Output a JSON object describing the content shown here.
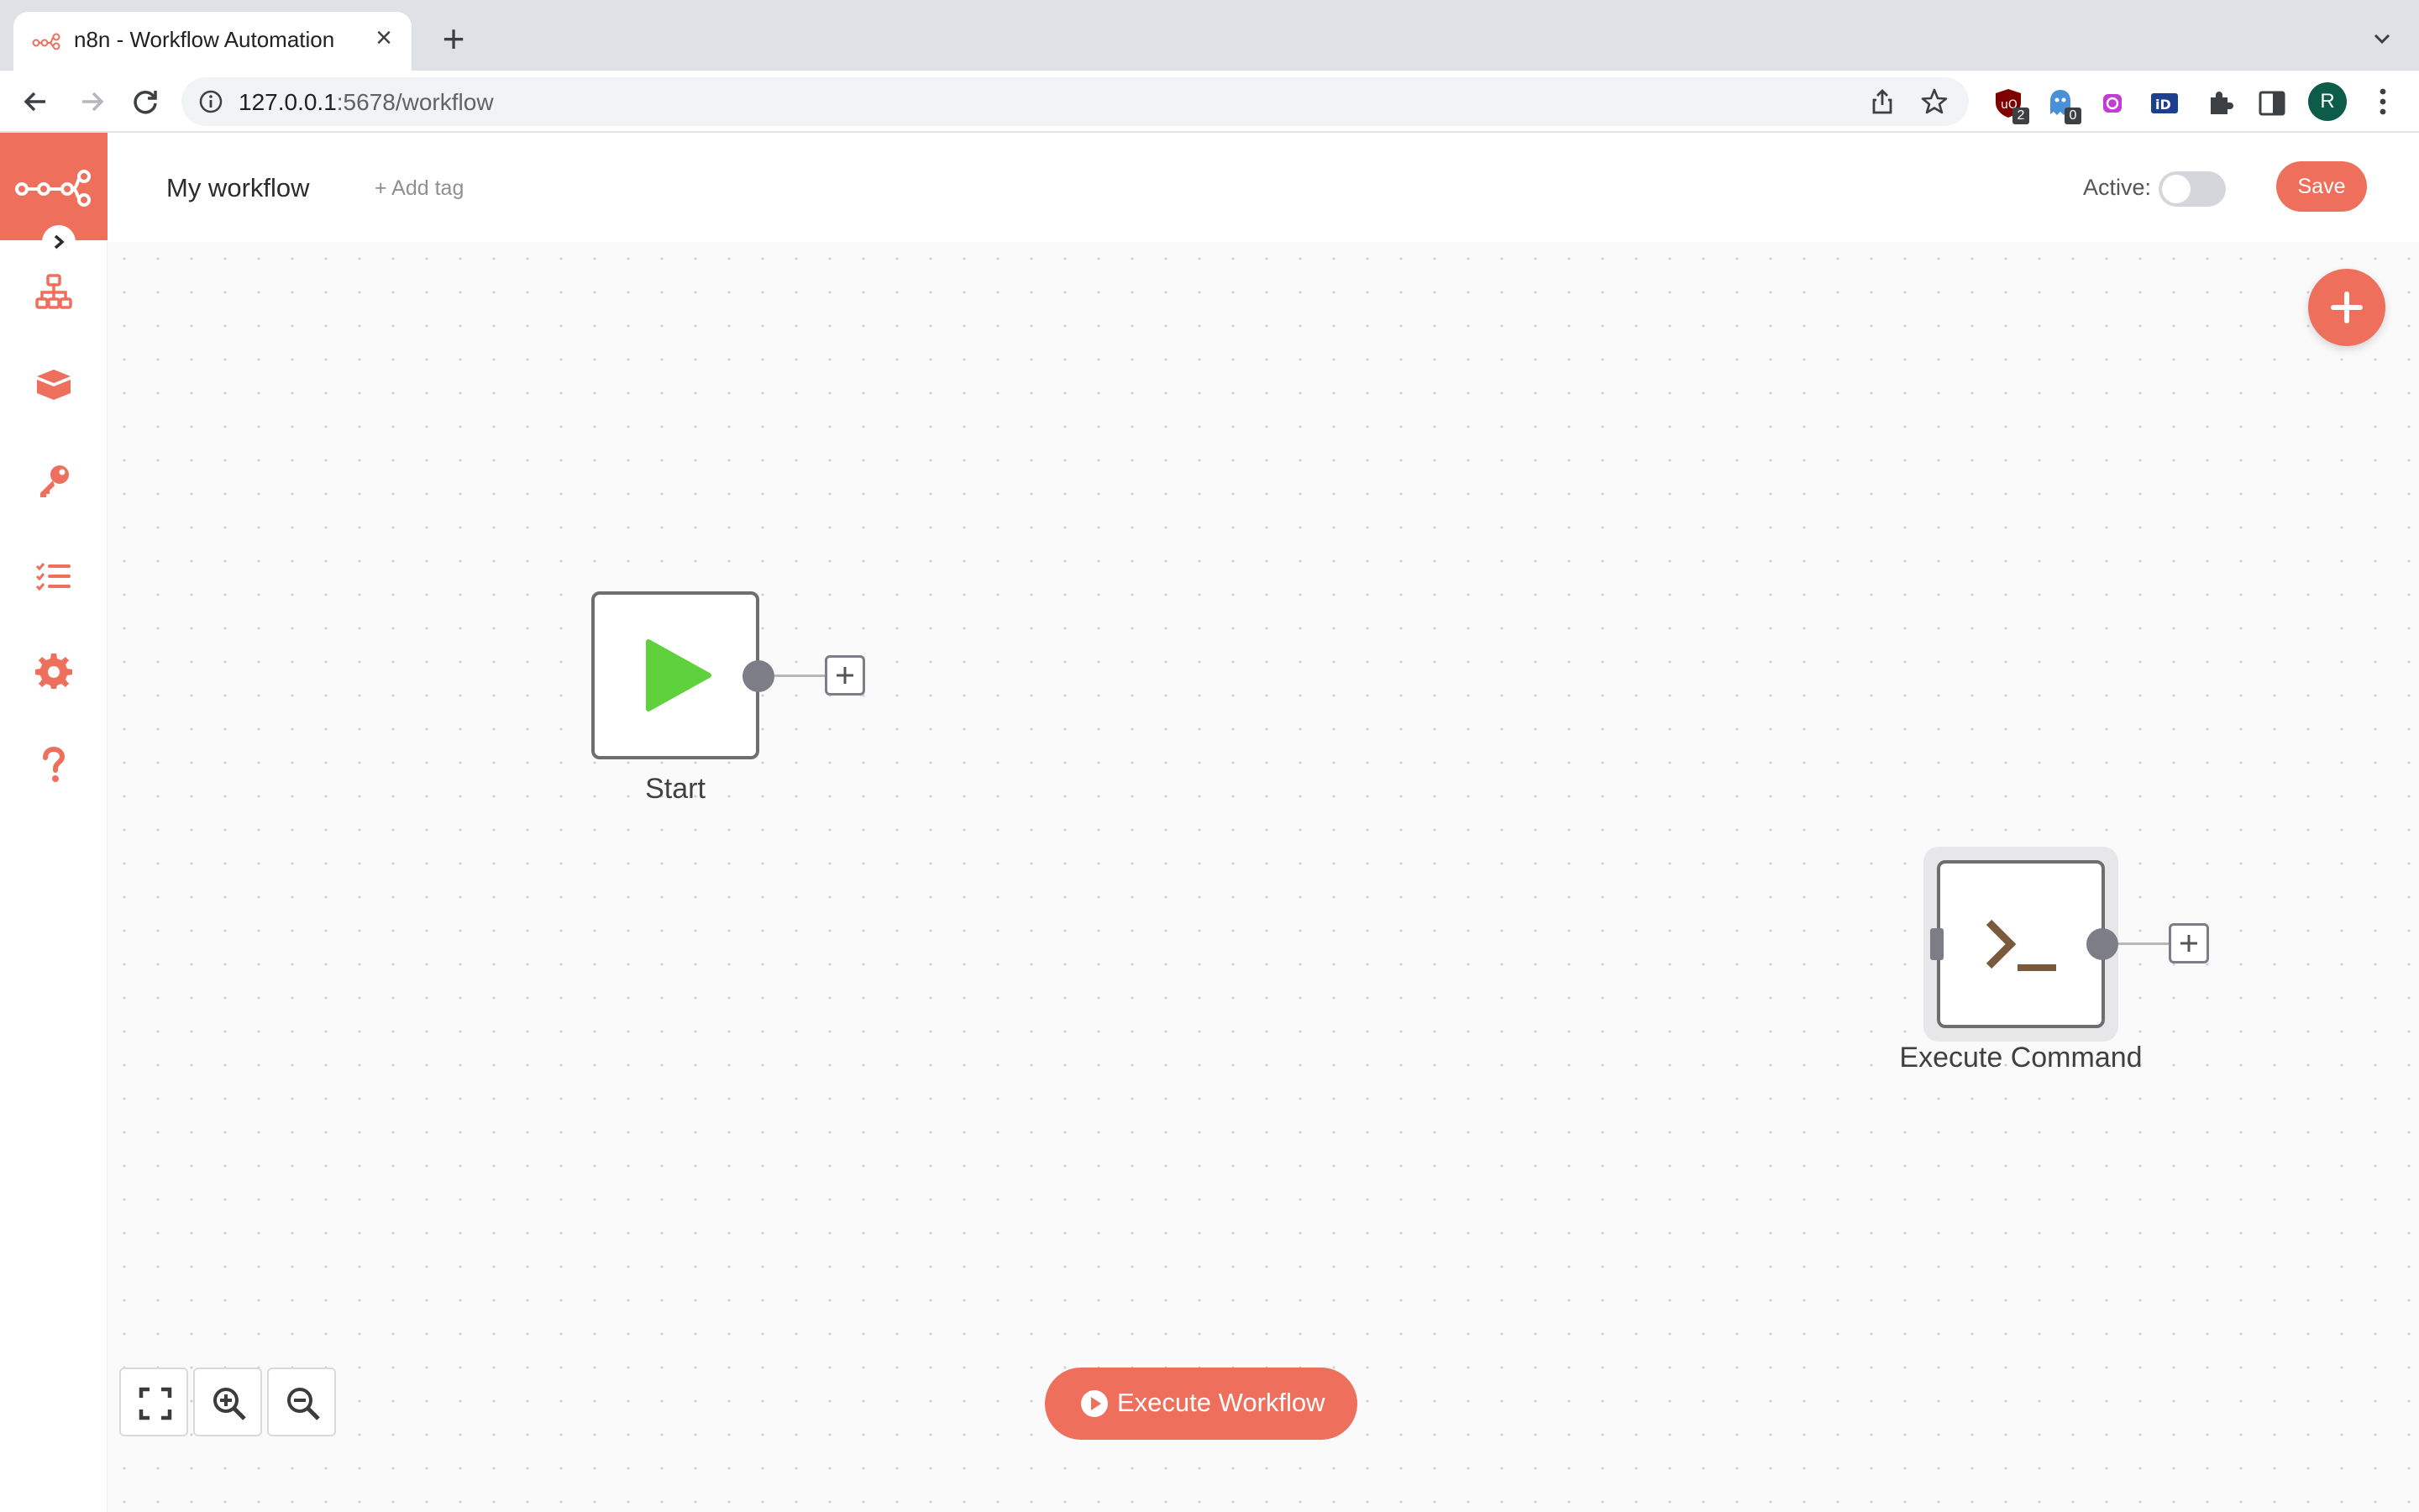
{
  "browser": {
    "tab_title": "n8n - Workflow Automation",
    "url_host": "127.0.0.1",
    "url_rest": ":5678/workflow",
    "extensions": [
      {
        "name": "ublock-origin-icon",
        "badge": "2"
      },
      {
        "name": "ghostery-icon",
        "badge": "0"
      },
      {
        "name": "extension-icon",
        "badge": ""
      },
      {
        "name": "id-icon",
        "badge": ""
      }
    ],
    "profile_initial": "R"
  },
  "header": {
    "workflow_name": "My workflow",
    "add_tag": "+ Add tag",
    "active_label": "Active:",
    "active": false,
    "save_label": "Save"
  },
  "sidebar": {
    "items": [
      {
        "name": "workflows-icon"
      },
      {
        "name": "templates-icon"
      },
      {
        "name": "credentials-icon"
      },
      {
        "name": "executions-icon"
      },
      {
        "name": "settings-icon"
      },
      {
        "name": "help-icon"
      }
    ]
  },
  "nodes": [
    {
      "label": "Start",
      "icon": "play-icon"
    },
    {
      "label": "Execute Command",
      "icon": "terminal-icon"
    }
  ],
  "footer": {
    "execute_label": "Execute Workflow"
  },
  "colors": {
    "accent": "#ee6f5c",
    "start_icon": "#5fd13d",
    "terminal_icon": "#7b5a3c"
  }
}
